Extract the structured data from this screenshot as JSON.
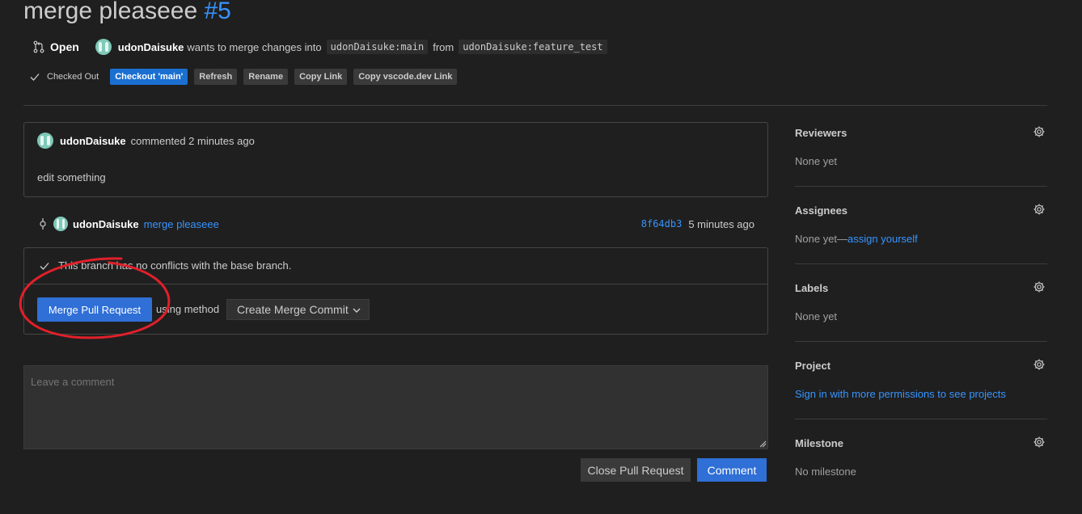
{
  "header": {
    "title": "merge pleaseee",
    "number": "#5"
  },
  "status": {
    "state": "Open",
    "author": "udonDaisuke",
    "text_merge": "wants to merge changes into",
    "base_branch": "udonDaisuke:main",
    "text_from": "from",
    "head_branch": "udonDaisuke:feature_test"
  },
  "actions": {
    "checked_out": "Checked Out",
    "checkout_main": "Checkout 'main'",
    "refresh": "Refresh",
    "rename": "Rename",
    "copy_link": "Copy Link",
    "copy_vscode": "Copy vscode.dev Link"
  },
  "comment": {
    "author": "udonDaisuke",
    "meta": "commented 2 minutes ago",
    "body": "edit something"
  },
  "commit": {
    "author": "udonDaisuke",
    "message": "merge pleaseee",
    "sha": "8f64db3",
    "time": "5 minutes ago"
  },
  "merge": {
    "status_text": "This branch has no conflicts with the base branch.",
    "merge_button": "Merge Pull Request",
    "using_method": "using method",
    "method_selected": "Create Merge Commit"
  },
  "composer": {
    "placeholder": "Leave a comment",
    "close_button": "Close Pull Request",
    "comment_button": "Comment"
  },
  "sidebar": {
    "reviewers": {
      "title": "Reviewers",
      "value": "None yet"
    },
    "assignees": {
      "title": "Assignees",
      "value": "None yet—",
      "link": "assign yourself"
    },
    "labels": {
      "title": "Labels",
      "value": "None yet"
    },
    "project": {
      "title": "Project",
      "link": "Sign in with more permissions to see projects"
    },
    "milestone": {
      "title": "Milestone",
      "value": "No milestone"
    }
  },
  "colors": {
    "background": "#1f1f1f",
    "accent": "#2f6fd6",
    "link": "#3794ff",
    "annotation": "#e0202a"
  }
}
